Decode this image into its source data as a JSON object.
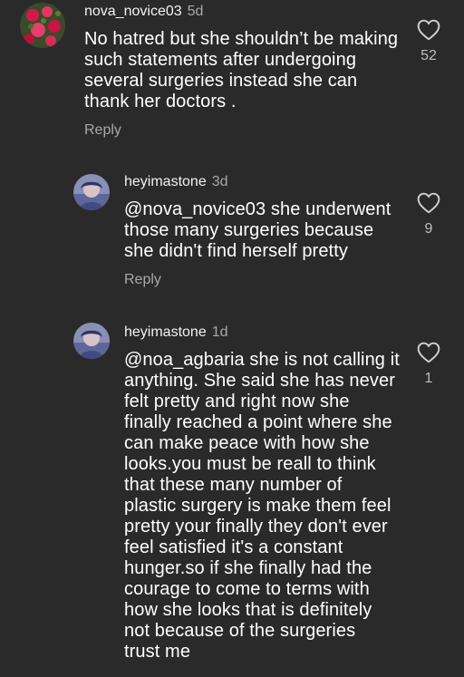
{
  "comments": [
    {
      "username": "nova_novice03",
      "time": "5d",
      "lines": [
        "No hatred but she shouldn’t be making",
        "such statements after undergoing",
        "several surgeries instead she can",
        "thank her doctors ."
      ],
      "reply_label": "Reply",
      "likes": "52"
    },
    {
      "username": "heyimastone",
      "time": "3d",
      "lines": [
        "@nova_novice03 she underwent",
        "those many surgeries because",
        "she didn't find herself pretty"
      ],
      "reply_label": "Reply",
      "likes": "9"
    },
    {
      "username": "heyimastone",
      "time": "1d",
      "lines": [
        "@noa_agbaria she is not calling it",
        "anything. She said she has never",
        "felt pretty and right now she",
        "finally reached a point where she",
        "can make peace with how she",
        "looks.you must be reall to think",
        "that these many number of",
        "plastic surgery is make them feel",
        "pretty your finally they don't ever",
        "feel satisfied it's a constant",
        "hunger.so if she finally had the",
        "courage to come to terms with",
        "how she looks that is definitely",
        "not because of the surgeries",
        "trust me"
      ],
      "likes": "1"
    }
  ],
  "colors": {
    "background": "#2a2a2a",
    "text": "#ffffff",
    "secondary": "#a8a8a8",
    "heart_outline": "#cfcfcf"
  }
}
